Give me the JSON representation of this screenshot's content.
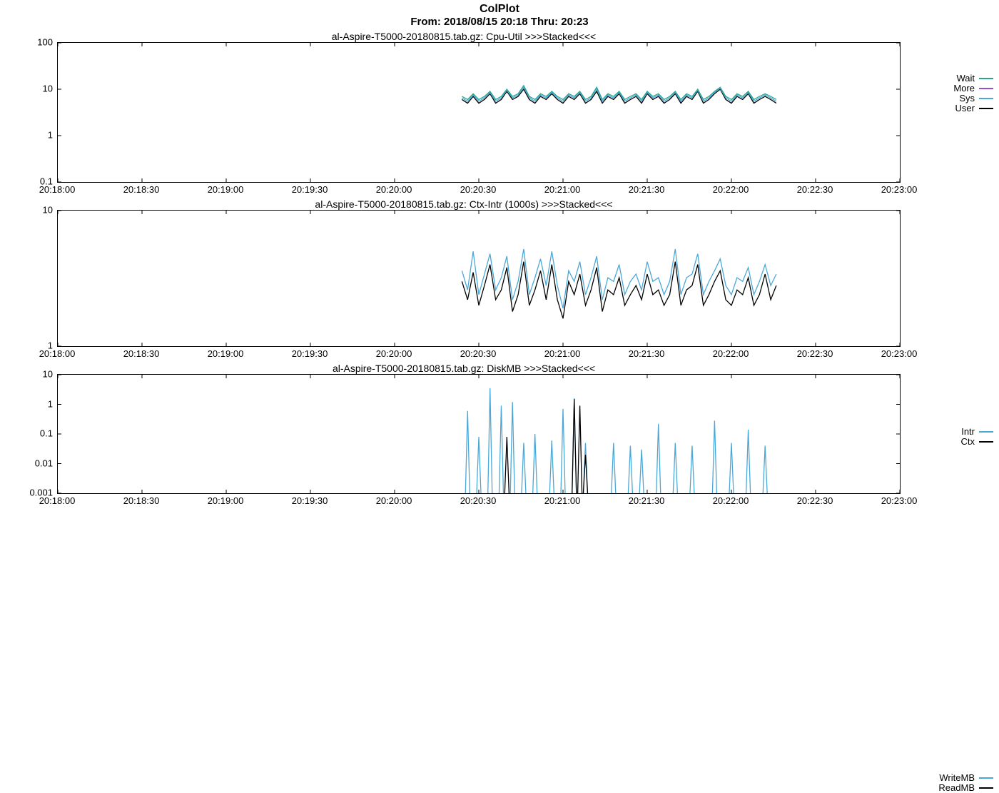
{
  "page_title": "ColPlot",
  "time_range": "From: 2018/08/15 20:18 Thru: 20:23",
  "x_ticks": [
    "20:18:00",
    "20:18:30",
    "20:19:00",
    "20:19:30",
    "20:20:00",
    "20:20:30",
    "20:21:00",
    "20:21:30",
    "20:22:00",
    "20:22:30",
    "20:23:00"
  ],
  "x_domain_sec": [
    0,
    300
  ],
  "colors": {
    "black": "#000000",
    "cyan": "#4aa8d8",
    "teal": "#2aa58b",
    "purple": "#9a4fd0"
  },
  "chart_data": [
    {
      "type": "line",
      "title": "al-Aspire-T5000-20180815.tab.gz: Cpu-Util >>>Stacked<<<",
      "yscale": "log",
      "ylim": [
        0.1,
        100
      ],
      "yticks": [
        0.1,
        1,
        10,
        100
      ],
      "legend": [
        {
          "name": "Wait",
          "color": "#2aa58b"
        },
        {
          "name": "More",
          "color": "#9a4fd0"
        },
        {
          "name": "Sys",
          "color": "#4aa8d8"
        },
        {
          "name": "User",
          "color": "#000000"
        }
      ],
      "x": [
        144,
        146,
        148,
        150,
        152,
        154,
        156,
        158,
        160,
        162,
        164,
        166,
        168,
        170,
        172,
        174,
        176,
        178,
        180,
        182,
        184,
        186,
        188,
        190,
        192,
        194,
        196,
        198,
        200,
        202,
        204,
        206,
        208,
        210,
        212,
        214,
        216,
        218,
        220,
        222,
        224,
        226,
        228,
        230,
        232,
        234,
        236,
        238,
        240,
        242,
        244,
        246,
        248,
        250,
        252,
        254,
        256
      ],
      "series": [
        {
          "name": "User",
          "color": "#000000",
          "values": [
            6,
            5,
            7,
            5,
            6,
            8,
            5,
            6,
            9,
            6,
            7,
            10,
            6,
            5,
            7,
            6,
            8,
            6,
            5,
            7,
            6,
            8,
            5,
            6,
            9,
            5,
            7,
            6,
            8,
            5,
            6,
            7,
            5,
            8,
            6,
            7,
            5,
            6,
            8,
            5,
            7,
            6,
            9,
            5,
            6,
            8,
            10,
            6,
            5,
            7,
            6,
            8,
            5,
            6,
            7,
            6,
            5
          ]
        },
        {
          "name": "Sys",
          "color": "#4aa8d8",
          "values": [
            6.5,
            5.5,
            7.5,
            5.5,
            6.5,
            8.5,
            5.5,
            6.5,
            9.5,
            6.5,
            7.5,
            11,
            6.5,
            5.5,
            7.5,
            6.5,
            8.5,
            6.5,
            5.5,
            7.5,
            6.5,
            8.5,
            5.5,
            6.5,
            10,
            5.5,
            7.5,
            6.5,
            8.5,
            5.5,
            6.5,
            7.5,
            5.5,
            8.5,
            6.5,
            7.5,
            5.5,
            6.5,
            8.5,
            5.5,
            7.5,
            6.5,
            9.5,
            5.5,
            6.5,
            8.5,
            10.5,
            6.5,
            5.5,
            7.5,
            6.5,
            8.5,
            5.5,
            6.5,
            7.5,
            6.5,
            5.5
          ]
        },
        {
          "name": "Wait",
          "color": "#2aa58b",
          "values": [
            7,
            6,
            8,
            6,
            7,
            9,
            6,
            7,
            10,
            7,
            8,
            12,
            7,
            6,
            8,
            7,
            9,
            7,
            6,
            8,
            7,
            9,
            6,
            7,
            11,
            6,
            8,
            7,
            9,
            6,
            7,
            8,
            6,
            9,
            7,
            8,
            6,
            7,
            9,
            6,
            8,
            7,
            10,
            6,
            7,
            9,
            11,
            7,
            6,
            8,
            7,
            9,
            6,
            7,
            8,
            7,
            6
          ]
        }
      ]
    },
    {
      "type": "line",
      "title": "al-Aspire-T5000-20180815.tab.gz: Ctx-Intr (1000s) >>>Stacked<<<",
      "yscale": "log",
      "ylim": [
        1,
        10
      ],
      "yticks": [
        1,
        10
      ],
      "legend": [
        {
          "name": "Intr",
          "color": "#4aa8d8"
        },
        {
          "name": "Ctx",
          "color": "#000000"
        }
      ],
      "x": [
        144,
        146,
        148,
        150,
        152,
        154,
        156,
        158,
        160,
        162,
        164,
        166,
        168,
        170,
        172,
        174,
        176,
        178,
        180,
        182,
        184,
        186,
        188,
        190,
        192,
        194,
        196,
        198,
        200,
        202,
        204,
        206,
        208,
        210,
        212,
        214,
        216,
        218,
        220,
        222,
        224,
        226,
        228,
        230,
        232,
        234,
        236,
        238,
        240,
        242,
        244,
        246,
        248,
        250,
        252,
        254,
        256
      ],
      "series": [
        {
          "name": "Ctx",
          "color": "#000000",
          "values": [
            3.0,
            2.2,
            3.5,
            2.0,
            2.8,
            4.0,
            2.2,
            2.6,
            3.8,
            1.8,
            2.4,
            4.2,
            2.0,
            2.6,
            3.6,
            2.2,
            4.0,
            2.2,
            1.6,
            3.0,
            2.4,
            3.4,
            2.0,
            2.6,
            3.8,
            1.8,
            2.6,
            2.4,
            3.2,
            2.0,
            2.4,
            2.8,
            2.2,
            3.4,
            2.4,
            2.6,
            2.0,
            2.4,
            4.2,
            2.0,
            2.6,
            2.8,
            4.0,
            2.0,
            2.4,
            3.0,
            3.6,
            2.2,
            2.0,
            2.6,
            2.4,
            3.2,
            2.0,
            2.4,
            3.4,
            2.2,
            2.8
          ]
        },
        {
          "name": "Intr",
          "color": "#4aa8d8",
          "values": [
            3.6,
            2.6,
            5.0,
            2.4,
            3.4,
            4.8,
            2.6,
            3.2,
            4.6,
            2.2,
            3.0,
            5.2,
            2.4,
            3.2,
            4.4,
            2.8,
            5.0,
            2.8,
            1.9,
            3.6,
            3.0,
            4.2,
            2.4,
            3.2,
            4.6,
            2.2,
            3.2,
            3.0,
            4.0,
            2.4,
            3.0,
            3.4,
            2.6,
            4.2,
            3.0,
            3.2,
            2.4,
            3.0,
            5.2,
            2.4,
            3.2,
            3.4,
            4.8,
            2.4,
            3.0,
            3.6,
            4.4,
            2.8,
            2.4,
            3.2,
            3.0,
            3.8,
            2.4,
            3.0,
            4.0,
            2.8,
            3.4
          ]
        }
      ]
    },
    {
      "type": "line",
      "title": "al-Aspire-T5000-20180815.tab.gz: DiskMB >>>Stacked<<<",
      "yscale": "log",
      "ylim": [
        0.001,
        10
      ],
      "yticks": [
        0.001,
        0.01,
        0.1,
        1,
        10
      ],
      "legend": [
        {
          "name": "WriteMB",
          "color": "#4aa8d8"
        },
        {
          "name": "ReadMB",
          "color": "#000000"
        }
      ],
      "spikes_write": [
        {
          "x": 146,
          "v": 0.6
        },
        {
          "x": 150,
          "v": 0.08
        },
        {
          "x": 154,
          "v": 3.5
        },
        {
          "x": 158,
          "v": 0.9
        },
        {
          "x": 162,
          "v": 1.2
        },
        {
          "x": 166,
          "v": 0.05
        },
        {
          "x": 170,
          "v": 0.1
        },
        {
          "x": 176,
          "v": 0.06
        },
        {
          "x": 180,
          "v": 0.7
        },
        {
          "x": 184,
          "v": 1.6
        },
        {
          "x": 188,
          "v": 0.05
        },
        {
          "x": 198,
          "v": 0.05
        },
        {
          "x": 204,
          "v": 0.04
        },
        {
          "x": 208,
          "v": 0.03
        },
        {
          "x": 214,
          "v": 0.22
        },
        {
          "x": 220,
          "v": 0.05
        },
        {
          "x": 226,
          "v": 0.04
        },
        {
          "x": 234,
          "v": 0.28
        },
        {
          "x": 240,
          "v": 0.05
        },
        {
          "x": 246,
          "v": 0.14
        },
        {
          "x": 252,
          "v": 0.04
        }
      ],
      "spikes_read": [
        {
          "x": 160,
          "v": 0.08
        },
        {
          "x": 184,
          "v": 1.5
        },
        {
          "x": 186,
          "v": 0.9
        },
        {
          "x": 188,
          "v": 0.02
        }
      ]
    }
  ]
}
